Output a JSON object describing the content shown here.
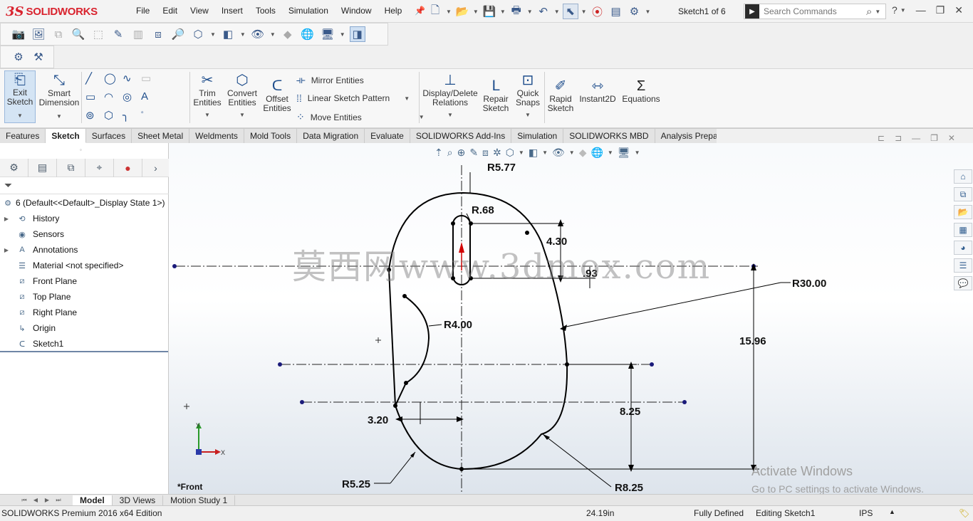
{
  "app": {
    "logo_prefix": "3S",
    "logo_name": "SOLIDWORKS"
  },
  "menu": [
    "File",
    "Edit",
    "View",
    "Insert",
    "Tools",
    "Simulation",
    "Window",
    "Help"
  ],
  "document_title": "Sketch1 of 6",
  "search": {
    "placeholder": "Search Commands"
  },
  "command_manager": {
    "exit_sketch": "Exit Sketch",
    "smart_dimension": "Smart Dimension",
    "trim_entities": "Trim Entities",
    "convert_entities": "Convert Entities",
    "offset_entities": "Offset Entities",
    "mirror_entities": "Mirror Entities",
    "linear_sketch_pattern": "Linear Sketch Pattern",
    "move_entities": "Move Entities",
    "display_delete_relations": "Display/Delete Relations",
    "repair_sketch": "Repair Sketch",
    "quick_snaps": "Quick Snaps",
    "rapid_sketch": "Rapid Sketch",
    "instant2d": "Instant2D",
    "equations": "Equations"
  },
  "tabs": [
    "Features",
    "Sketch",
    "Surfaces",
    "Sheet Metal",
    "Weldments",
    "Mold Tools",
    "Data Migration",
    "Evaluate",
    "SOLIDWORKS Add-Ins",
    "Simulation",
    "SOLIDWORKS MBD",
    "Analysis Preparation"
  ],
  "active_tab": "Sketch",
  "tree": {
    "root": "6  (Default<<Default>_Display State 1>)",
    "items": [
      "History",
      "Sensors",
      "Annotations",
      "Material <not specified>",
      "Front Plane",
      "Top Plane",
      "Right Plane",
      "Origin",
      "Sketch1"
    ]
  },
  "canvas": {
    "view_label": "*Front",
    "watermark": "莫西网www.3dmox.com",
    "dimensions": [
      "R5.77",
      "R.68",
      "4.30",
      ".93",
      "R30.00",
      "R4.00",
      "15.96",
      "8.25",
      "3.20",
      "R5.25",
      "R8.25"
    ],
    "triad_y": "Y",
    "triad_x": "X",
    "activate_line1": "Activate Windows",
    "activate_line2": "Go to PC settings to activate Windows."
  },
  "bottom_tabs": [
    "Model",
    "3D Views",
    "Motion Study 1"
  ],
  "status": {
    "edition": "SOLIDWORKS Premium 2016 x64 Edition",
    "length": "24.19in",
    "state": "Fully Defined",
    "mode": "Editing Sketch1",
    "units": "IPS"
  },
  "colors": {
    "brand": "#d9232e",
    "accent": "#1f4e8c",
    "sketch": "#000000",
    "dimension_arrow": "#d10000"
  }
}
